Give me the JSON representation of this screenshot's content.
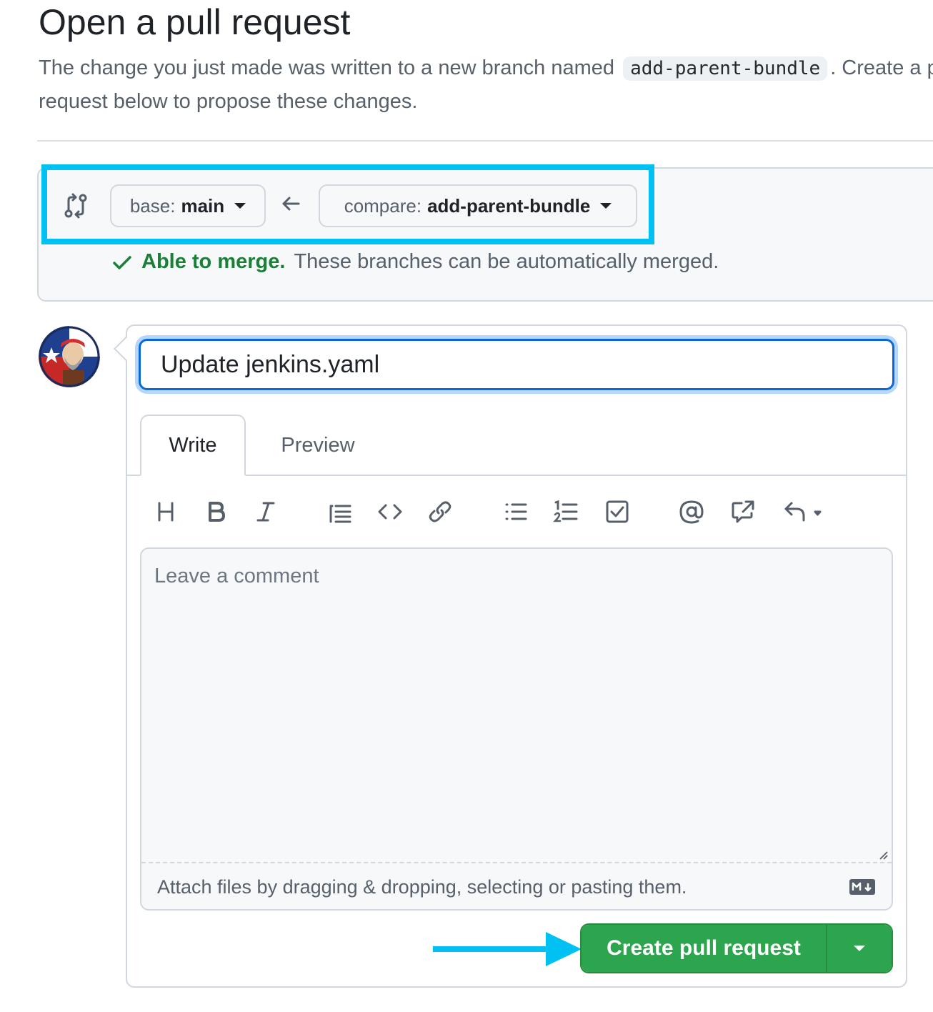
{
  "header": {
    "title": "Open a pull request",
    "description_before": "The change you just made was written to a new branch named",
    "branch_name": "add-parent-bundle",
    "description_after": ". Create a pull request below to propose these changes."
  },
  "range": {
    "base_label": "base:",
    "base_value": "main",
    "compare_label": "compare:",
    "compare_value": "add-parent-bundle",
    "merge_ok": "Able to merge.",
    "merge_text": "These branches can be automatically merged."
  },
  "form": {
    "title_value": "Update jenkins.yaml",
    "tabs": [
      {
        "label": "Write",
        "active": true
      },
      {
        "label": "Preview",
        "active": false
      }
    ],
    "toolbar_icons": [
      "heading-icon",
      "bold-icon",
      "italic-icon",
      "quote-icon",
      "code-icon",
      "link-icon",
      "unordered-list-icon",
      "ordered-list-icon",
      "task-list-icon",
      "mention-icon",
      "reference-icon",
      "reply-icon"
    ],
    "comment_placeholder": "Leave a comment",
    "attach_text": "Attach files by dragging & dropping, selecting or pasting them.",
    "submit_label": "Create pull request"
  },
  "colors": {
    "accent_highlight": "#00c1f1",
    "success_green": "#2da44e",
    "focus_blue": "#0969da"
  }
}
